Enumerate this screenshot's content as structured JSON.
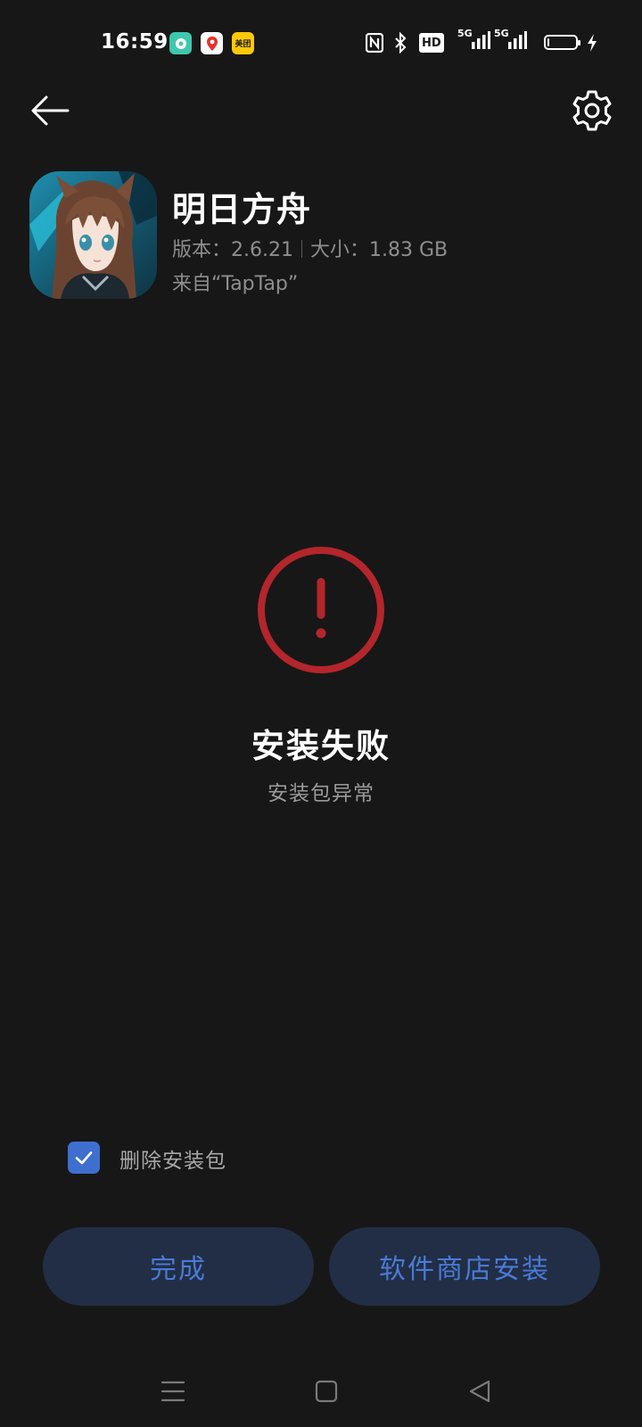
{
  "status_bar": {
    "time": "16:59",
    "notification_icons": [
      "soul-app-icon",
      "map-pin-app-icon",
      "meituan-app-icon"
    ],
    "meituan_label": "美团",
    "indicators": [
      "nfc-icon",
      "bluetooth-icon",
      "hd-icon",
      "signal-5g-icon",
      "signal-5g-icon",
      "battery-icon",
      "charging-icon"
    ],
    "hd_label": "HD",
    "network_1": "5G",
    "network_2": "5G",
    "battery_level": 0.05
  },
  "header": {
    "back_icon": "arrow-left-icon",
    "settings_icon": "gear-icon"
  },
  "app": {
    "name": "明日方舟",
    "version_label": "版本：2.6.21",
    "size_label": "大小：1.83 GB",
    "source": "来自“TapTap”"
  },
  "result": {
    "icon": "error-exclamation-icon",
    "title": "安装失败",
    "subtitle": "安装包异常",
    "accent_color": "#b3262b"
  },
  "options": {
    "delete_package_label": "删除安装包",
    "delete_package_checked": true,
    "checkbox_color": "#3e6fcf"
  },
  "actions": {
    "done_label": "完成",
    "store_install_label": "软件商店安装",
    "button_text_color": "#4a7ad6",
    "button_bg_color": "#212e45"
  },
  "nav_bar": {
    "icons": [
      "menu-icon",
      "home-square-icon",
      "back-triangle-icon"
    ]
  }
}
